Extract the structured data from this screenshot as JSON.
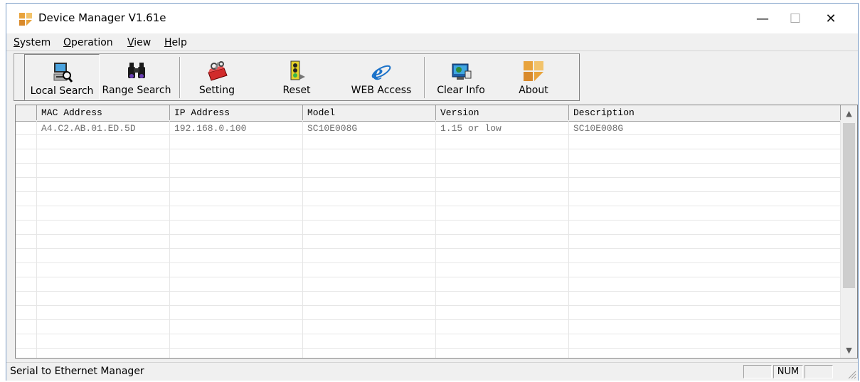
{
  "window": {
    "title": "Device Manager V1.61e",
    "minimize": "—",
    "maximize": "☐",
    "close": "✕"
  },
  "menu": [
    {
      "label": "System",
      "mnemonic": "S",
      "rest": "ystem"
    },
    {
      "label": "Operation",
      "mnemonic": "O",
      "rest": "peration"
    },
    {
      "label": "View",
      "mnemonic": "V",
      "rest": "iew"
    },
    {
      "label": "Help",
      "mnemonic": "H",
      "rest": "elp"
    }
  ],
  "toolbar": {
    "local_search": "Local Search",
    "range_search": "Range Search",
    "setting": "Setting",
    "reset": "Reset",
    "web_access": "WEB Access",
    "clear_info": "Clear Info",
    "about": "About"
  },
  "grid": {
    "columns": [
      "MAC Address",
      "IP Address",
      "Model",
      "Version",
      "Description"
    ],
    "rows": [
      [
        "A4.C2.AB.01.ED.5D",
        "192.168.0.100",
        "SC10E008G",
        "1.15 or low",
        "SC10E008G"
      ]
    ]
  },
  "scrollbar": {
    "up": "▲",
    "down": "▼"
  },
  "status": {
    "text": "Serial to Ethernet Manager",
    "num": "NUM"
  },
  "colors": {
    "window_border": "#7a9cc6",
    "row_text": "#707070",
    "logo_orange": "#e8a33c"
  }
}
